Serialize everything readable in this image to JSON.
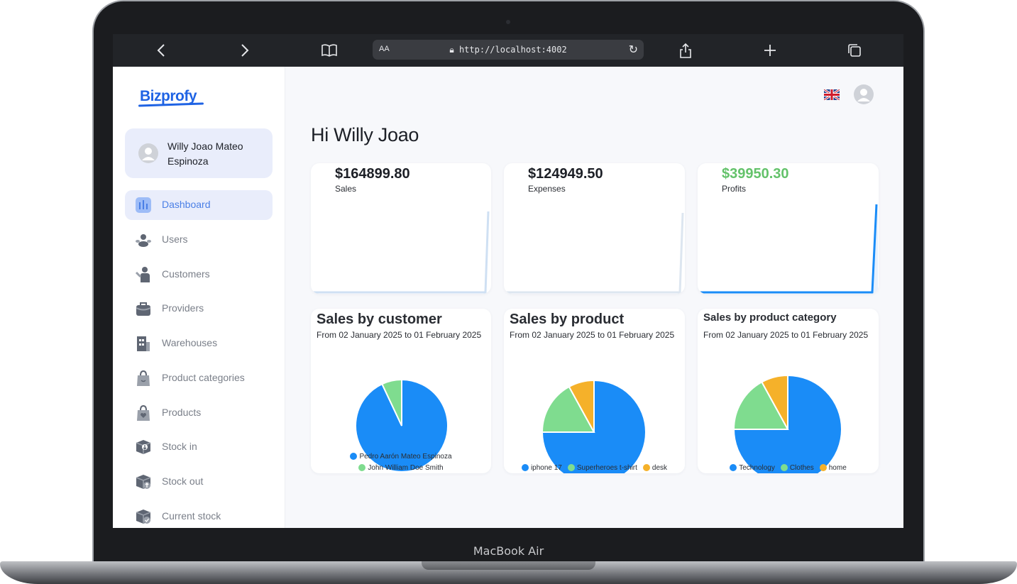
{
  "device": {
    "label": "MacBook Air"
  },
  "browser": {
    "aa_label": "AA",
    "url": "http://localhost:4002"
  },
  "sidebar": {
    "logo": "Bizprofy",
    "user_name": "Willy Joao Mateo Espinoza",
    "items": [
      {
        "label": "Dashboard",
        "icon": "chart-icon",
        "active": true
      },
      {
        "label": "Users",
        "icon": "users-icon"
      },
      {
        "label": "Customers",
        "icon": "customer-icon"
      },
      {
        "label": "Providers",
        "icon": "briefcase-icon"
      },
      {
        "label": "Warehouses",
        "icon": "building-icon"
      },
      {
        "label": "Product categories",
        "icon": "bag-icon"
      },
      {
        "label": "Products",
        "icon": "lock-bag-icon"
      },
      {
        "label": "Stock in",
        "icon": "box-in-icon"
      },
      {
        "label": "Stock out",
        "icon": "box-out-icon"
      },
      {
        "label": "Current stock",
        "icon": "box-check-icon"
      }
    ]
  },
  "main": {
    "greeting": "Hi Willy Joao",
    "stats": [
      {
        "value": "$164899.80",
        "label": "Sales",
        "color": "#1c1f26"
      },
      {
        "value": "$124949.50",
        "label": "Expenses",
        "color": "#1c1f26"
      },
      {
        "value": "$39950.30",
        "label": "Profits",
        "color": "#63c26a"
      }
    ],
    "colors": {
      "blue": "#1a8cf7",
      "green": "#7fdc8f",
      "orange": "#f5b12a",
      "primary": "#1f63e4"
    }
  },
  "chart_data": [
    {
      "type": "pie",
      "title": "Sales by customer",
      "subtitle": "From 02 January 2025 to 01 February 2025",
      "categories": [
        "Pedro Aarón Mateo Espinoza",
        "John William Doe Smith"
      ],
      "values": [
        93,
        7
      ]
    },
    {
      "type": "pie",
      "title": "Sales by product",
      "subtitle": "From 02 January 2025 to 01 February 2025",
      "categories": [
        "iphone 17",
        "Superheroes t-shirt",
        "desk"
      ],
      "values": [
        75,
        17,
        8
      ]
    },
    {
      "type": "pie",
      "title": "Sales by product category",
      "subtitle": "From 02 January 2025 to 01 February 2025",
      "categories": [
        "Technology",
        "Clothes",
        "home"
      ],
      "values": [
        75,
        17,
        8
      ]
    }
  ]
}
